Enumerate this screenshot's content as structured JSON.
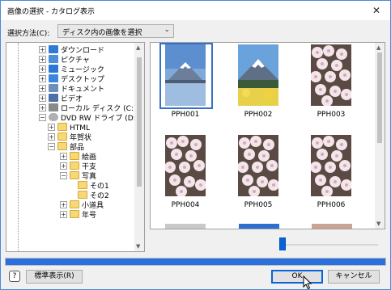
{
  "window": {
    "title": "画像の選択 - カタログ表示",
    "close_glyph": "✕"
  },
  "selector": {
    "label": "選択方法(C):",
    "value": "ディスク内の画像を選択"
  },
  "tree": {
    "items": [
      {
        "label": "ダウンロード",
        "icon": "download-icon"
      },
      {
        "label": "ピクチャ",
        "icon": "pictures-icon"
      },
      {
        "label": "ミュージック",
        "icon": "music-icon"
      },
      {
        "label": "デスクトップ",
        "icon": "desktop-icon"
      },
      {
        "label": "ドキュメント",
        "icon": "documents-icon"
      },
      {
        "label": "ビデオ",
        "icon": "video-icon"
      },
      {
        "label": "ローカル ディスク (C:)",
        "icon": "drive-icon"
      },
      {
        "label": "DVD RW ドライブ (D:) D",
        "icon": "dvd-icon"
      },
      {
        "label": "HTML",
        "icon": "folder-icon"
      },
      {
        "label": "年賀状",
        "icon": "folder-icon"
      },
      {
        "label": "部品",
        "icon": "folder-open-icon"
      },
      {
        "label": "絵画",
        "icon": "folder-icon"
      },
      {
        "label": "干支",
        "icon": "folder-icon"
      },
      {
        "label": "写真",
        "icon": "folder-open-icon"
      },
      {
        "label": "その1",
        "icon": "folder-icon"
      },
      {
        "label": "その2",
        "icon": "folder-icon"
      },
      {
        "label": "小道具",
        "icon": "folder-icon"
      },
      {
        "label": "年号",
        "icon": "folder-icon"
      }
    ]
  },
  "thumbnails": [
    {
      "caption": "PPH001",
      "subject": "mountain-lake",
      "selected": true
    },
    {
      "caption": "PPH002",
      "subject": "mountain-field",
      "selected": false
    },
    {
      "caption": "PPH003",
      "subject": "cherry-blossom",
      "selected": false
    },
    {
      "caption": "PPH004",
      "subject": "cherry-blossom",
      "selected": false
    },
    {
      "caption": "PPH005",
      "subject": "cherry-blossom",
      "selected": false
    },
    {
      "caption": "PPH006",
      "subject": "cherry-blossom",
      "selected": false
    }
  ],
  "zoom_slider": {
    "value_fraction": 0.0
  },
  "progress": {
    "value_fraction": 1.0
  },
  "buttons": {
    "help_glyph": "?",
    "standard_view": "標準表示(R)",
    "ok": "OK",
    "cancel": "キャンセル"
  },
  "colors": {
    "accent": "#0a63d6",
    "progress": "#2a6fdb",
    "folder": "#f8d775"
  }
}
